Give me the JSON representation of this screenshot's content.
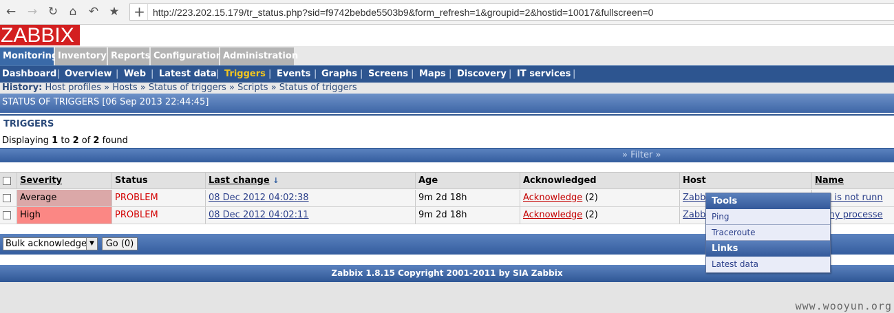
{
  "browser": {
    "url": "http://223.202.15.179/tr_status.php?sid=f9742bebde5503b9&form_refresh=1&groupid=2&hostid=10017&fullscreen=0",
    "buttons": [
      "back-icon",
      "forward-icon",
      "reload-icon",
      "home-icon",
      "undo-icon",
      "star-icon",
      "new-tab-icon"
    ]
  },
  "logo": "ZABBIX",
  "main_menu": [
    "Monitoring",
    "Inventory",
    "Reports",
    "Configuration",
    "Administration"
  ],
  "sub_menu": [
    "Dashboard",
    "Overview",
    "Web",
    "Latest data",
    "Triggers",
    "Events",
    "Graphs",
    "Screens",
    "Maps",
    "Discovery",
    "IT services"
  ],
  "history": {
    "label": "History:",
    "items": [
      "Host profiles",
      "Hosts",
      "Status of triggers",
      "Scripts",
      "Status of triggers"
    ],
    "separator": "»"
  },
  "title": "STATUS OF TRIGGERS [06 Sep 2013 22:44:45]",
  "section": "TRIGGERS",
  "displaying": {
    "prefix": "Displaying",
    "from": "1",
    "to_word": "to",
    "to": "2",
    "of_word": "of",
    "total": "2",
    "suffix": "found"
  },
  "filter_label": "Filter",
  "table": {
    "headers": [
      "Severity",
      "Status",
      "Last change",
      "Age",
      "Acknowledged",
      "Host",
      "Name"
    ],
    "rows": [
      {
        "severity": "Average",
        "status": "PROBLEM",
        "last_change": "08 Dec 2012 04:02:38",
        "age": "9m 2d 18h",
        "ack": "Acknowledge",
        "ack_count": "(2)",
        "host": "Zabbi",
        "name": "ogd is not runn"
      },
      {
        "severity": "High",
        "status": "PROBLEM",
        "last_change": "08 Dec 2012 04:02:11",
        "age": "9m 2d 18h",
        "ack": "Acknowledge",
        "ack_count": "(2)",
        "host": "Zabbi",
        "name": "many processe"
      }
    ]
  },
  "bulk": {
    "selected": "Bulk acknowledge",
    "go": "Go (0)"
  },
  "footer": "Zabbix 1.8.15 Copyright 2001-2011 by SIA Zabbix",
  "popup": {
    "tools_header": "Tools",
    "tools": [
      "Ping",
      "Traceroute"
    ],
    "links_header": "Links",
    "links": [
      "Latest data"
    ]
  },
  "watermark": "www.wooyun.org",
  "colors": {
    "severity_average": "#dba8a8",
    "severity_high": "#fb8784",
    "problem": "#d30000",
    "brand": "#d31f20",
    "active_submenu": "#f2c61f"
  }
}
